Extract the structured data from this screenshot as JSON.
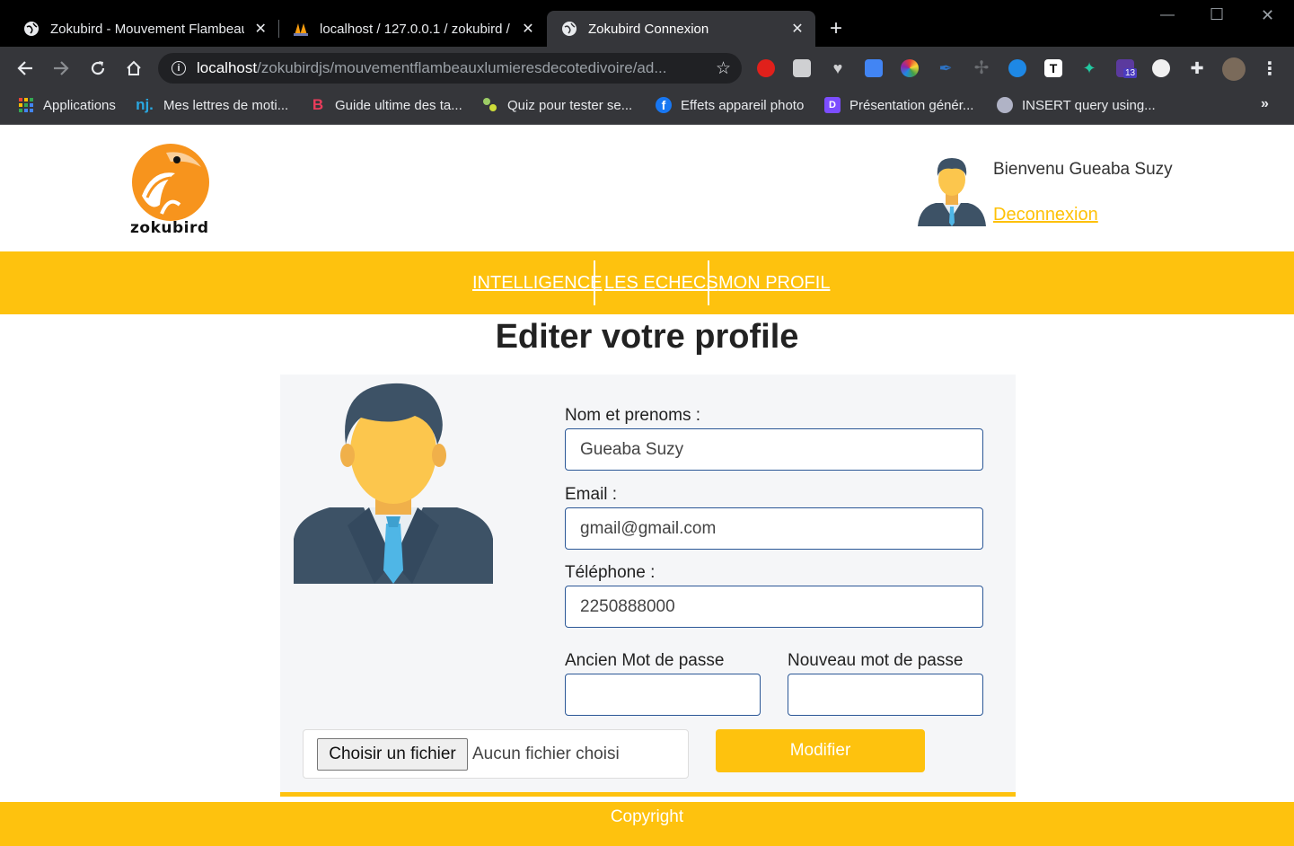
{
  "browser": {
    "tabs": [
      {
        "title": "Zokubird - Mouvement Flambeau",
        "active": false
      },
      {
        "title": "localhost / 127.0.0.1 / zokubird /",
        "active": false
      },
      {
        "title": "Zokubird Connexion",
        "active": true
      }
    ],
    "url_host": "localhost",
    "url_path": "/zokubirdjs/mouvementflambeauxlumieresdecotedivoire/ad...",
    "extension_badge": "13",
    "bookmarks": [
      {
        "label": "Applications",
        "icon": "apps-grid-icon"
      },
      {
        "label": "Mes lettres de moti...",
        "icon": "nj-icon",
        "icon_text": "nj."
      },
      {
        "label": "Guide ultime des ta...",
        "icon": "b-logo-icon",
        "icon_text": "B"
      },
      {
        "label": "Quiz pour tester se...",
        "icon": "quiz-icon"
      },
      {
        "label": "Effets appareil photo",
        "icon": "facebook-icon",
        "icon_text": "f"
      },
      {
        "label": "Présentation génér...",
        "icon": "d-logo-icon",
        "icon_text": "D"
      },
      {
        "label": "INSERT query using...",
        "icon": "db-icon"
      }
    ]
  },
  "header": {
    "logo_text": "zokubird",
    "welcome": "Bienvenu Gueaba Suzy",
    "logout": "Deconnexion"
  },
  "nav": {
    "items": [
      "INTELLIGENCE",
      "LES ECHECS",
      "MON PROFIL"
    ]
  },
  "main": {
    "title": "Editer votre profile",
    "form": {
      "name_label": "Nom et prenoms :",
      "name_value": "Gueaba Suzy",
      "email_label": "Email :",
      "email_value": "gmail@gmail.com",
      "phone_label": "Téléphone :",
      "phone_value": "2250888000",
      "old_password_label": "Ancien Mot de passe",
      "new_password_label": "Nouveau mot de passe",
      "file_button": "Choisir un fichier",
      "file_status": "Aucun fichier choisi",
      "submit": "Modifier"
    }
  },
  "footer": {
    "text": "Copyright"
  },
  "colors": {
    "accent": "#fec20e",
    "field_border": "#2b5796"
  }
}
